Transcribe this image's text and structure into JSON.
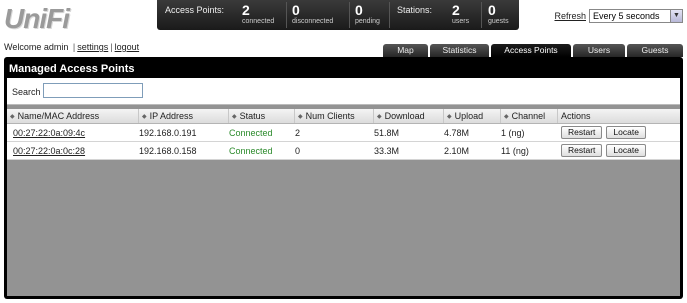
{
  "app": {
    "logo_text": "UniFi"
  },
  "stats": {
    "access_points_label": "Access Points:",
    "stations_label": "Stations:",
    "ap_connected": {
      "value": "2",
      "label": "connected"
    },
    "ap_disconnected": {
      "value": "0",
      "label": "disconnected"
    },
    "ap_pending": {
      "value": "0",
      "label": "pending"
    },
    "sta_users": {
      "value": "2",
      "label": "users"
    },
    "sta_guests": {
      "value": "0",
      "label": "guests"
    }
  },
  "refresh": {
    "link_label": "Refresh",
    "selected_option": "Every 5 seconds"
  },
  "user": {
    "welcome_text": "Welcome admin",
    "separator": "|",
    "settings_label": "settings",
    "logout_label": "logout"
  },
  "tabs": [
    {
      "label": "Map",
      "active": false
    },
    {
      "label": "Statistics",
      "active": false
    },
    {
      "label": "Access Points",
      "active": true
    },
    {
      "label": "Users",
      "active": false
    },
    {
      "label": "Guests",
      "active": false
    }
  ],
  "main": {
    "title": "Managed Access Points",
    "search_label": "Search",
    "search_value": ""
  },
  "table": {
    "columns": [
      "Name/MAC Address",
      "IP Address",
      "Status",
      "Num Clients",
      "Download",
      "Upload",
      "Channel",
      "Actions"
    ],
    "sort_icon": "sort-icon",
    "rows": [
      {
        "mac": "00:27:22:0a:09:4c",
        "ip": "192.168.0.191",
        "status": "Connected",
        "clients": "2",
        "download": "51.8M",
        "upload": "4.78M",
        "channel": "1 (ng)",
        "restart_label": "Restart",
        "locate_label": "Locate"
      },
      {
        "mac": "00:27:22:0a:0c:28",
        "ip": "192.168.0.158",
        "status": "Connected",
        "clients": "0",
        "download": "33.3M",
        "upload": "2.10M",
        "channel": "11 (ng)",
        "restart_label": "Restart",
        "locate_label": "Locate"
      }
    ]
  },
  "colors": {
    "status_connected": "#2a8a2a",
    "panel_background": "#000000",
    "content_background": "#939393"
  }
}
